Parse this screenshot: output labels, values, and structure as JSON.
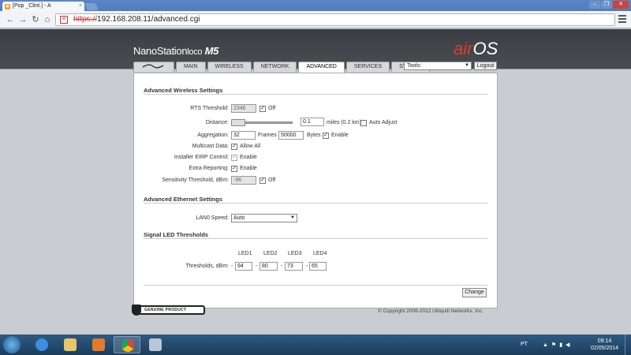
{
  "browser": {
    "tab_title": "[Pop _Clint.] - A",
    "tab_close": "×",
    "address_scheme": "https://",
    "address_rest": "192.168.208.11/advanced.cgi",
    "window_buttons": [
      "–",
      "❐",
      "✕"
    ]
  },
  "header": {
    "brand_name": "NanoStation",
    "brand_suffix": "loco",
    "brand_model": "M5",
    "airos_prefix": "air",
    "airos_suffix": "OS",
    "tabs": [
      "MAIN",
      "WIRELESS",
      "NETWORK",
      "ADVANCED",
      "SERVICES",
      "SYSTEM"
    ],
    "active_tab": "ADVANCED",
    "tools_label": "Tools:",
    "logout_label": "Logout"
  },
  "wireless": {
    "section_title": "Advanced Wireless Settings",
    "rts_label": "RTS Threshold:",
    "rts_value": "2346",
    "rts_off_label": "Off",
    "distance_label": "Distance:",
    "distance_value": "0.1",
    "distance_unit": "miles (0.2 km)",
    "auto_adjust_label": "Auto Adjust",
    "aggregation_label": "Aggregation:",
    "aggregation_frames_value": "32",
    "frames_label": "Frames",
    "aggregation_bytes_value": "50000",
    "bytes_label": "Bytes",
    "aggregation_enable_label": "Enable",
    "multicast_label": "Multicast Data:",
    "multicast_value_label": "Allow All",
    "eirp_label": "Installer EIRP Control:",
    "eirp_value_label": "Enable",
    "extra_label": "Extra Reporting:",
    "extra_value_label": "Enable",
    "sensitivity_label": "Sensitivity Threshold, dBm:",
    "sensitivity_value": "-96",
    "sensitivity_off_label": "Off"
  },
  "ethernet": {
    "section_title": "Advanced Ethernet Settings",
    "lan0_label": "LAN0 Speed:",
    "lan0_value": "Auto"
  },
  "led": {
    "section_title": "Signal LED Thresholds",
    "thresholds_label": "Thresholds, dBm:",
    "headers": [
      "LED1",
      "LED2",
      "LED3",
      "LED4"
    ],
    "values": [
      "94",
      "80",
      "73",
      "65"
    ],
    "sign": "-"
  },
  "footer": {
    "change_label": "Change",
    "genuine_label": "GENUINE PRODUCT",
    "copyright": "© Copyright 2006-2012 Ubiquiti Networks, Inc."
  },
  "taskbar": {
    "language": "PT",
    "time": "09:14",
    "date": "02/05/2014"
  },
  "colors": {
    "airos_red": "#e23a2e",
    "header_dark": "#3a3d42",
    "taskbar_blue": "#1c3d5c"
  }
}
